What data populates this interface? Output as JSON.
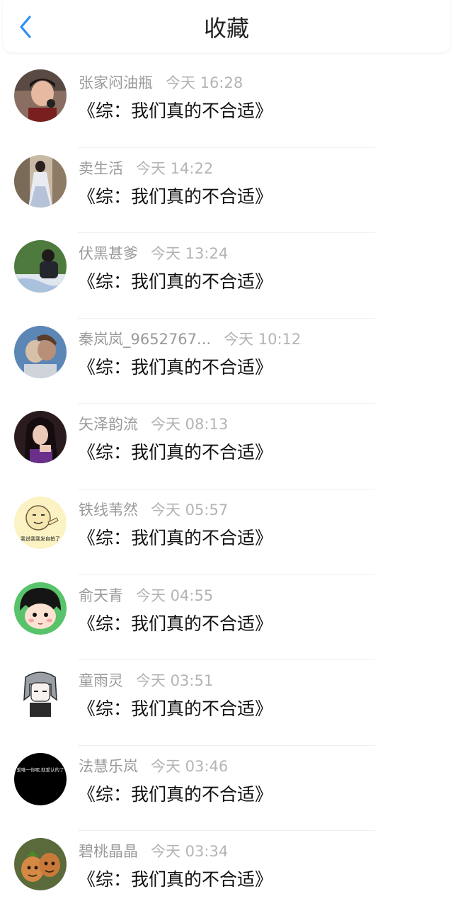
{
  "header": {
    "title": "收藏",
    "back_icon": "chevron-left-icon",
    "accent_color": "#2f8ff0"
  },
  "items": [
    {
      "name": "张家闷油瓶",
      "time": "今天 16:28",
      "content": "《综：我们真的不合适》",
      "avatar": "photo-boy-microphone"
    },
    {
      "name": "卖生活",
      "time": "今天 14:22",
      "content": "《综：我们真的不合适》",
      "avatar": "photo-girl-white-dress"
    },
    {
      "name": "伏黑甚爹",
      "time": "今天 13:24",
      "content": "《综：我们真的不合适》",
      "avatar": "photo-person-trees"
    },
    {
      "name": "秦岚岚_9652767...",
      "time": "今天 10:12",
      "content": "《综：我们真的不合适》",
      "avatar": "photo-couple"
    },
    {
      "name": "矢泽韵流",
      "time": "今天 08:13",
      "content": "《综：我们真的不合适》",
      "avatar": "photo-girl-dark-hair"
    },
    {
      "name": "铁线苇然",
      "time": "今天 05:57",
      "content": "《综：我们真的不合适》",
      "avatar": "meme-face",
      "avatar_caption": "我说我我发自拍了"
    },
    {
      "name": "俞天青",
      "time": "今天 04:55",
      "content": "《综：我们真的不合适》",
      "avatar": "cartoon-girl-green"
    },
    {
      "name": "童雨灵",
      "time": "今天 03:51",
      "content": "《综：我们真的不合适》",
      "avatar": "anime-grey-hair"
    },
    {
      "name": "法慧乐岚",
      "time": "今天 03:46",
      "content": "《综：我们真的不合适》",
      "avatar": "black-text",
      "avatar_caption": "爱唯一你呢,就爱认的了"
    },
    {
      "name": "碧桃晶晶",
      "time": "今天 03:34",
      "content": "《综：我们真的不合适》",
      "avatar": "photo-two-faces"
    }
  ]
}
